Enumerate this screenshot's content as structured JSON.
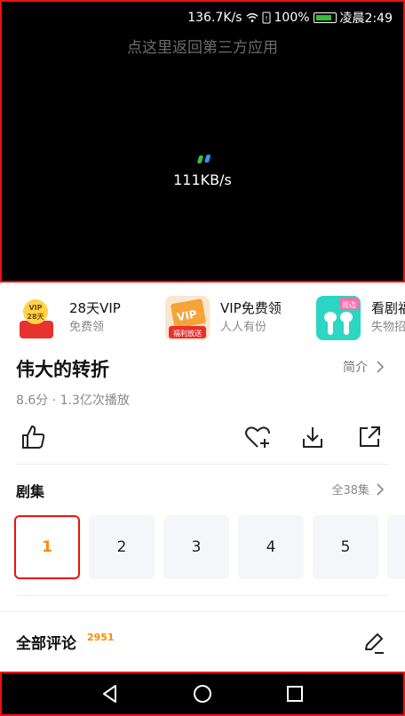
{
  "status_bar": {
    "speed": "136.7K/s",
    "battery": "100%",
    "time": "凌晨2:49"
  },
  "player": {
    "return_text": "点这里返回第三方应用",
    "loading_speed": "111KB/s"
  },
  "promos": [
    {
      "title": "28天VIP",
      "subtitle": "免费领",
      "badge": "VIP 28天"
    },
    {
      "title": "VIP免费领",
      "subtitle": "人人有份",
      "badge": "福利放送"
    },
    {
      "title": "看剧福",
      "subtitle": "失物招",
      "badge": "周边"
    }
  ],
  "show": {
    "title": "伟大的转折",
    "intro_label": "简介",
    "meta": "8.6分 · 1.3亿次播放"
  },
  "episodes": {
    "section_title": "剧集",
    "count_label": "全38集",
    "items": [
      "1",
      "2",
      "3",
      "4",
      "5",
      ""
    ]
  },
  "comments": {
    "title": "全部评论",
    "count": "2951"
  },
  "colors": {
    "accent": "#ff8a00",
    "highlight_border": "#ee1111"
  }
}
